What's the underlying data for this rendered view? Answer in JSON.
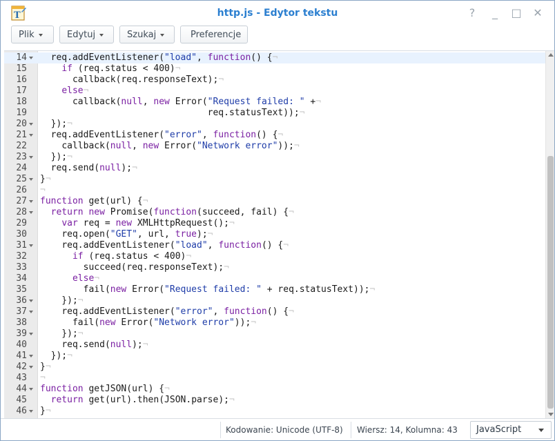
{
  "window": {
    "title": "http.js - Edytor tekstu",
    "controls": [
      "?",
      "_",
      "□",
      "✕"
    ]
  },
  "toolbar": {
    "file_label": "Plik",
    "edit_label": "Edytuj",
    "search_label": "Szukaj",
    "prefs_label": "Preferencje"
  },
  "editor": {
    "current_line": 14,
    "lines": [
      {
        "n": "14",
        "fold": true,
        "text": "  req.addEventListener(\"load\", function() {"
      },
      {
        "n": "15",
        "fold": false,
        "text": "    if (req.status < 400)"
      },
      {
        "n": "16",
        "fold": false,
        "text": "      callback(req.responseText);"
      },
      {
        "n": "17",
        "fold": false,
        "text": "    else"
      },
      {
        "n": "18",
        "fold": false,
        "text": "      callback(null, new Error(\"Request failed: \" +"
      },
      {
        "n": "19",
        "fold": false,
        "text": "                               req.statusText));"
      },
      {
        "n": "20",
        "fold": true,
        "text": "  });"
      },
      {
        "n": "21",
        "fold": true,
        "text": "  req.addEventListener(\"error\", function() {"
      },
      {
        "n": "22",
        "fold": false,
        "text": "    callback(null, new Error(\"Network error\"));"
      },
      {
        "n": "23",
        "fold": true,
        "text": "  });"
      },
      {
        "n": "24",
        "fold": false,
        "text": "  req.send(null);"
      },
      {
        "n": "25",
        "fold": true,
        "text": "}"
      },
      {
        "n": "26",
        "fold": false,
        "text": ""
      },
      {
        "n": "27",
        "fold": true,
        "text": "function get(url) {"
      },
      {
        "n": "28",
        "fold": true,
        "text": "  return new Promise(function(succeed, fail) {"
      },
      {
        "n": "29",
        "fold": false,
        "text": "    var req = new XMLHttpRequest();"
      },
      {
        "n": "30",
        "fold": false,
        "text": "    req.open(\"GET\", url, true);"
      },
      {
        "n": "31",
        "fold": true,
        "text": "    req.addEventListener(\"load\", function() {"
      },
      {
        "n": "32",
        "fold": false,
        "text": "      if (req.status < 400)"
      },
      {
        "n": "33",
        "fold": false,
        "text": "        succeed(req.responseText);"
      },
      {
        "n": "34",
        "fold": false,
        "text": "      else"
      },
      {
        "n": "35",
        "fold": false,
        "text": "        fail(new Error(\"Request failed: \" + req.statusText));"
      },
      {
        "n": "36",
        "fold": true,
        "text": "    });"
      },
      {
        "n": "37",
        "fold": true,
        "text": "    req.addEventListener(\"error\", function() {"
      },
      {
        "n": "38",
        "fold": false,
        "text": "      fail(new Error(\"Network error\"));"
      },
      {
        "n": "39",
        "fold": true,
        "text": "    });"
      },
      {
        "n": "40",
        "fold": false,
        "text": "    req.send(null);"
      },
      {
        "n": "41",
        "fold": true,
        "text": "  });"
      },
      {
        "n": "42",
        "fold": true,
        "text": "}"
      },
      {
        "n": "43",
        "fold": false,
        "text": ""
      },
      {
        "n": "44",
        "fold": true,
        "text": "function getJSON(url) {"
      },
      {
        "n": "45",
        "fold": false,
        "text": "  return get(url).then(JSON.parse);"
      },
      {
        "n": "46",
        "fold": true,
        "text": "}"
      }
    ]
  },
  "status": {
    "encoding": "Kodowanie: Unicode (UTF-8)",
    "position": "Wiersz: 14, Kolumna: 43",
    "language": "JavaScript"
  },
  "colors": {
    "title": "#2b7fd0",
    "keyword": "#7a1fa2",
    "string": "#1e3ca8",
    "current_line": "#e8f2fe"
  }
}
